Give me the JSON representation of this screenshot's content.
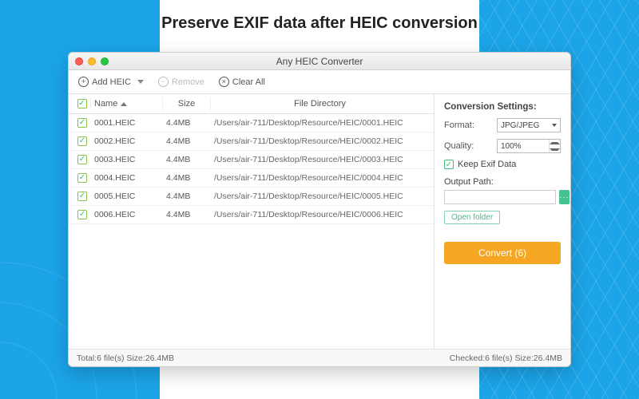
{
  "headline": "Preserve EXIF data after HEIC conversion",
  "window": {
    "title": "Any HEIC Converter"
  },
  "toolbar": {
    "add_label": "Add HEIC",
    "remove_label": "Remove",
    "clear_label": "Clear All"
  },
  "table": {
    "headers": {
      "name": "Name",
      "size": "Size",
      "dir": "File Directory"
    },
    "rows": [
      {
        "name": "0001.HEIC",
        "size": "4.4MB",
        "dir": "/Users/air-711/Desktop/Resource/HEIC/0001.HEIC"
      },
      {
        "name": "0002.HEIC",
        "size": "4.4MB",
        "dir": "/Users/air-711/Desktop/Resource/HEIC/0002.HEIC"
      },
      {
        "name": "0003.HEIC",
        "size": "4.4MB",
        "dir": "/Users/air-711/Desktop/Resource/HEIC/0003.HEIC"
      },
      {
        "name": "0004.HEIC",
        "size": "4.4MB",
        "dir": "/Users/air-711/Desktop/Resource/HEIC/0004.HEIC"
      },
      {
        "name": "0005.HEIC",
        "size": "4.4MB",
        "dir": "/Users/air-711/Desktop/Resource/HEIC/0005.HEIC"
      },
      {
        "name": "0006.HEIC",
        "size": "4.4MB",
        "dir": "/Users/air-711/Desktop/Resource/HEIC/0006.HEIC"
      }
    ]
  },
  "settings": {
    "title": "Conversion Settings:",
    "format_label": "Format:",
    "format_value": "JPG/JPEG",
    "quality_label": "Quality:",
    "quality_value": "100%",
    "keep_exif_label": "Keep Exif Data",
    "output_path_label": "Output Path:",
    "output_path_value": "",
    "browse_label": "···",
    "open_folder_label": "Open folder",
    "convert_label": "Convert (6)"
  },
  "status": {
    "left": "Total:6 file(s) Size:26.4MB",
    "right": "Checked:6 file(s) Size:26.4MB"
  }
}
